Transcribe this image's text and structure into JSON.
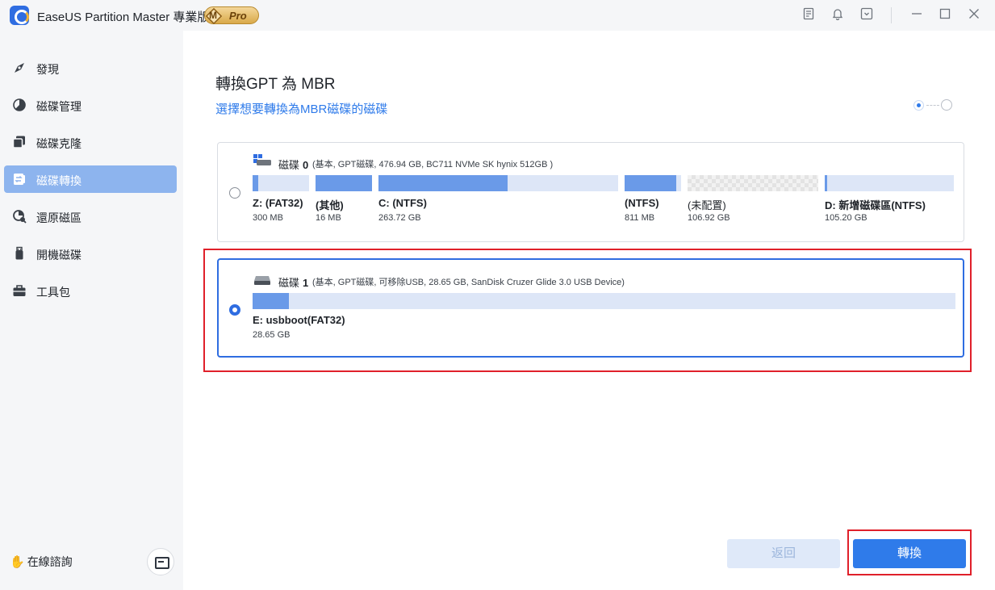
{
  "app": {
    "title": "EaseUS Partition Master 專業版",
    "badge_letter": "M",
    "badge_text": "Pro",
    "titlebar_icons": [
      "notes-icon",
      "bell-icon",
      "dropdown-icon",
      "minimize-icon",
      "maximize-icon",
      "close-icon"
    ]
  },
  "sidebar": {
    "items": [
      {
        "label": "發現",
        "icon": "compass-icon",
        "active": false
      },
      {
        "label": "磁碟管理",
        "icon": "pie-chart-icon",
        "active": false
      },
      {
        "label": "磁碟克隆",
        "icon": "clone-icon",
        "active": false
      },
      {
        "label": "磁碟轉換",
        "icon": "convert-icon",
        "active": true
      },
      {
        "label": "還原磁區",
        "icon": "recover-icon",
        "active": false
      },
      {
        "label": "開機磁碟",
        "icon": "usb-icon",
        "active": false
      },
      {
        "label": "工具包",
        "icon": "toolbox-icon",
        "active": false
      }
    ],
    "chat_label": "在線諮詢",
    "chat_icon": "waving-hand-icon",
    "feedback_icon": "feedback-icon"
  },
  "main": {
    "title": "轉換GPT 為 MBR",
    "subtitle": "選擇想要轉換為MBR磁碟的磁碟",
    "step_current": 1,
    "step_total": 2,
    "disks": [
      {
        "name": "磁碟",
        "number": "0",
        "info": "(基本, GPT磁碟, 476.94 GB, BC711 NVMe SK hynix 512GB )",
        "selected": false,
        "partitions": [
          {
            "label": "Z: (FAT32)",
            "size": "300 MB",
            "fill": 0.1,
            "unallocated": false
          },
          {
            "label": "(其他)",
            "size": "16 MB",
            "fill": 1.0,
            "unallocated": false
          },
          {
            "label": "C: (NTFS)",
            "size": "263.72 GB",
            "fill": 0.54,
            "unallocated": false
          },
          {
            "label": "(NTFS)",
            "size": "811 MB",
            "fill": 1.0,
            "unallocated": false
          },
          {
            "label": "(未配置)",
            "size": "106.92 GB",
            "fill": 0,
            "unallocated": true
          },
          {
            "label": "D: 新增磁碟區(NTFS)",
            "size": "105.20 GB",
            "fill": 0.02,
            "unallocated": false
          }
        ]
      },
      {
        "name": "磁碟",
        "number": "1",
        "info": "(基本, GPT磁碟, 可移除USB, 28.65 GB, SanDisk Cruzer Glide 3.0 USB Device)",
        "selected": true,
        "partitions": [
          {
            "label": "E: usbboot(FAT32)",
            "size": "28.65 GB",
            "fill": 0.05,
            "unallocated": false
          }
        ]
      }
    ]
  },
  "buttons": {
    "back": "返回",
    "convert": "轉換"
  },
  "colors": {
    "accent": "#2f7bea",
    "highlight": "#e0202a",
    "partition_used": "#6a9ae8",
    "partition_free": "#dde6f7"
  }
}
